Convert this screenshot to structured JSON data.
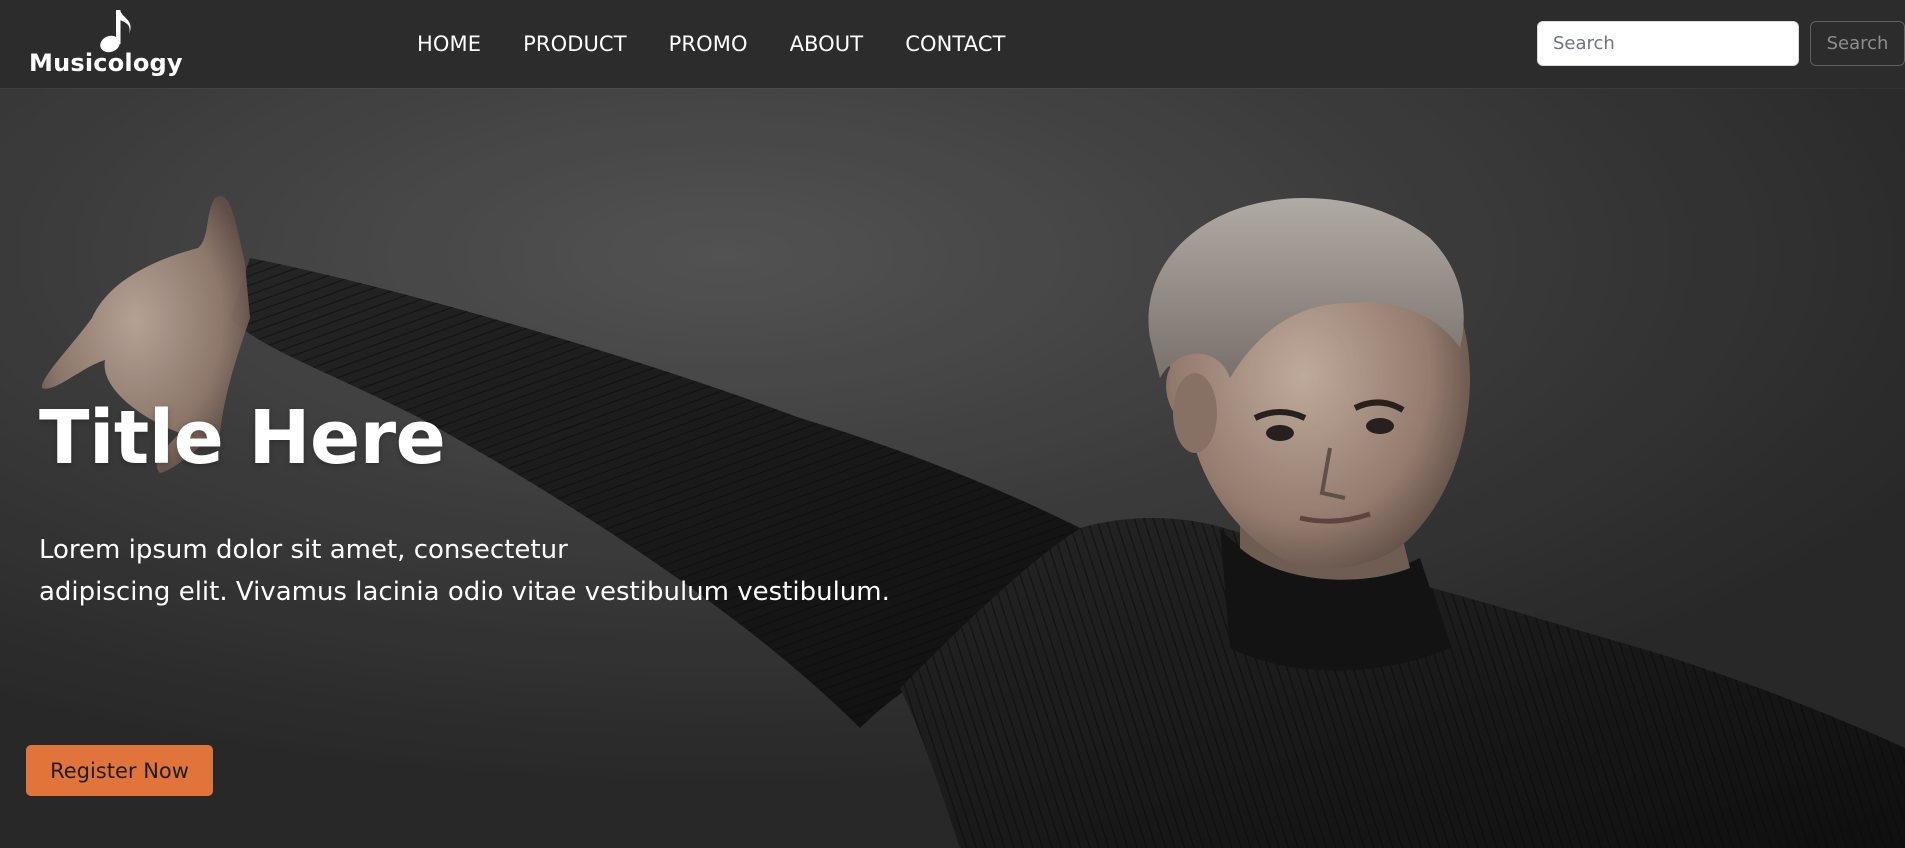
{
  "brand": {
    "name": "Musicology",
    "icon": "music-note-icon"
  },
  "nav": {
    "links": [
      {
        "label": "HOME"
      },
      {
        "label": "PRODUCT"
      },
      {
        "label": "PROMO"
      },
      {
        "label": "ABOUT"
      },
      {
        "label": "CONTACT"
      }
    ]
  },
  "search": {
    "placeholder": "Search",
    "button_label": "Search"
  },
  "hero": {
    "title": "Title Here",
    "text_line1": "Lorem ipsum dolor sit amet, consectetur",
    "text_line2": "adipiscing elit. Vivamus lacinia odio vitae vestibulum vestibulum.",
    "cta_label": "Register Now",
    "image": "man-in-black-turtleneck-arm-outstretched"
  },
  "colors": {
    "navbar_bg": "#2c2c2c",
    "accent": "#e0743a",
    "text": "#ffffff"
  }
}
